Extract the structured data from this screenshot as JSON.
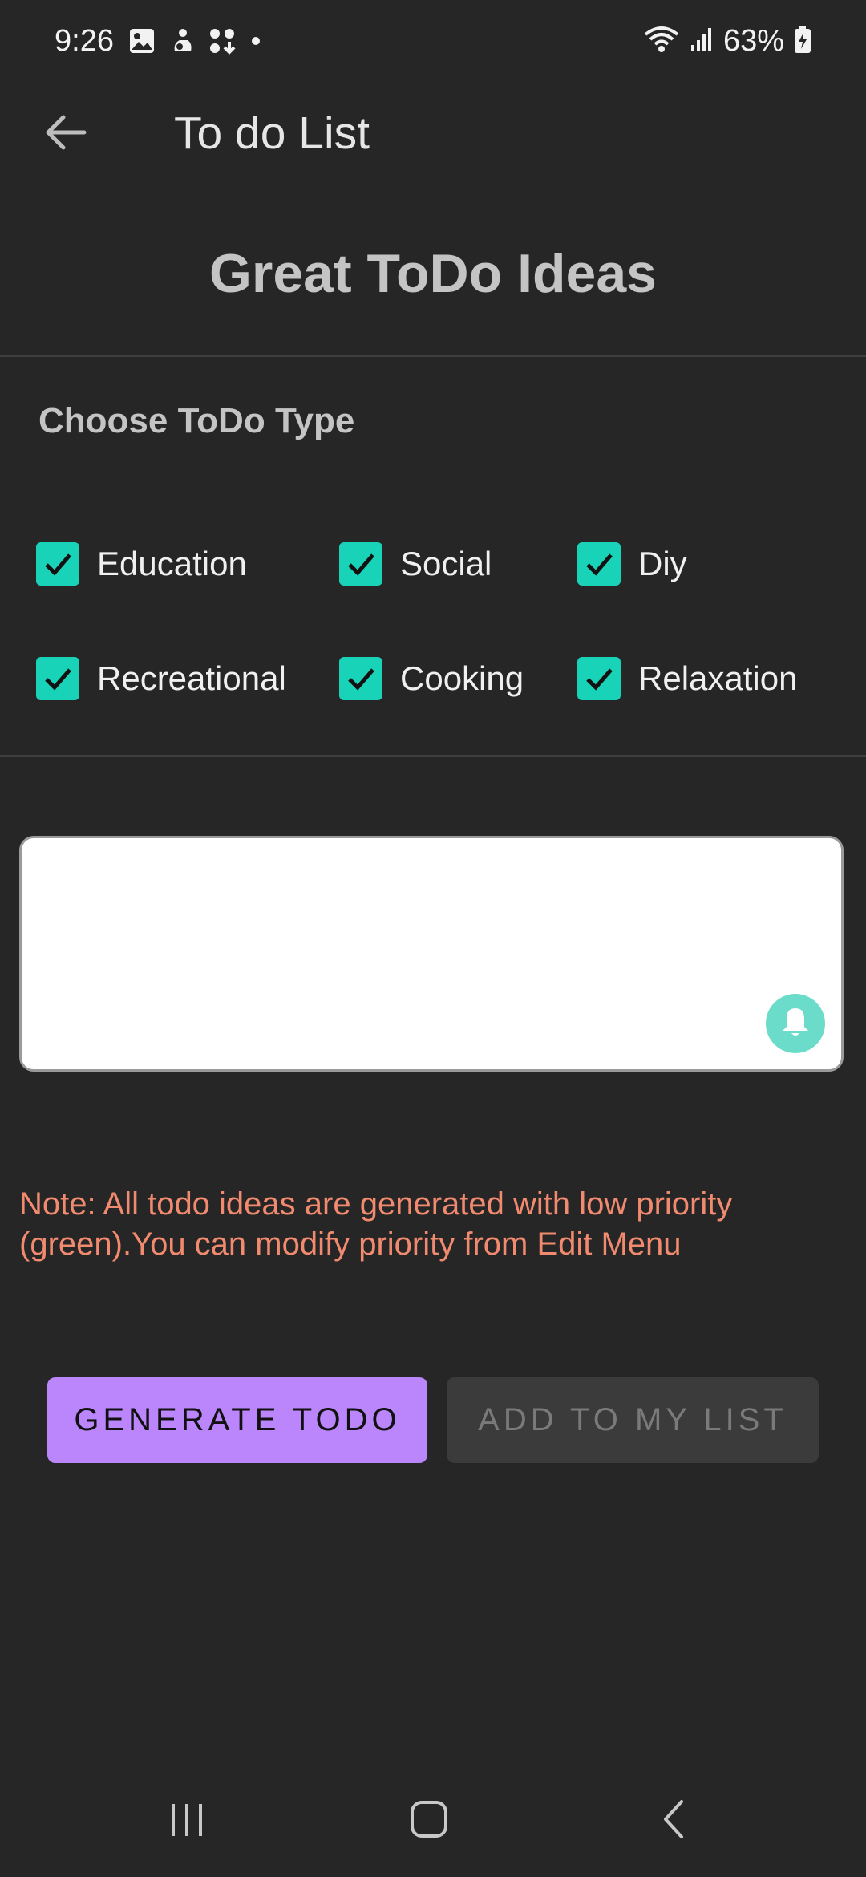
{
  "status_bar": {
    "time": "9:26",
    "battery": "63%",
    "left_icons": [
      "gallery-icon",
      "accessibility-icon",
      "app-download-icon",
      "dot-icon"
    ],
    "right_icons": [
      "wifi-icon",
      "signal-icon",
      "battery-icon"
    ]
  },
  "app_bar": {
    "title": "To do List",
    "back_icon": "arrow-back-icon"
  },
  "heading": "Great ToDo Ideas",
  "section_label": "Choose ToDo Type",
  "todo_types": [
    {
      "label": "Education",
      "checked": true
    },
    {
      "label": "Social",
      "checked": true
    },
    {
      "label": "Diy",
      "checked": true
    },
    {
      "label": "Recreational",
      "checked": true
    },
    {
      "label": "Cooking",
      "checked": true
    },
    {
      "label": "Relaxation",
      "checked": true
    }
  ],
  "output": {
    "value": "",
    "bell_icon": "bell-icon"
  },
  "note": "Note: All todo ideas are generated with low priority (green).You can modify priority from Edit Menu",
  "buttons": {
    "generate": "GENERATE TODO",
    "add": "ADD TO MY LIST"
  },
  "colors": {
    "background": "#262627",
    "accent_checkbox": "#19d3b9",
    "primary_button": "#bb86fc",
    "note_text": "#f18a6e",
    "bell": "#6cdcca"
  },
  "nav_bar": {
    "items": [
      "recents-icon",
      "home-icon",
      "back-icon"
    ]
  }
}
